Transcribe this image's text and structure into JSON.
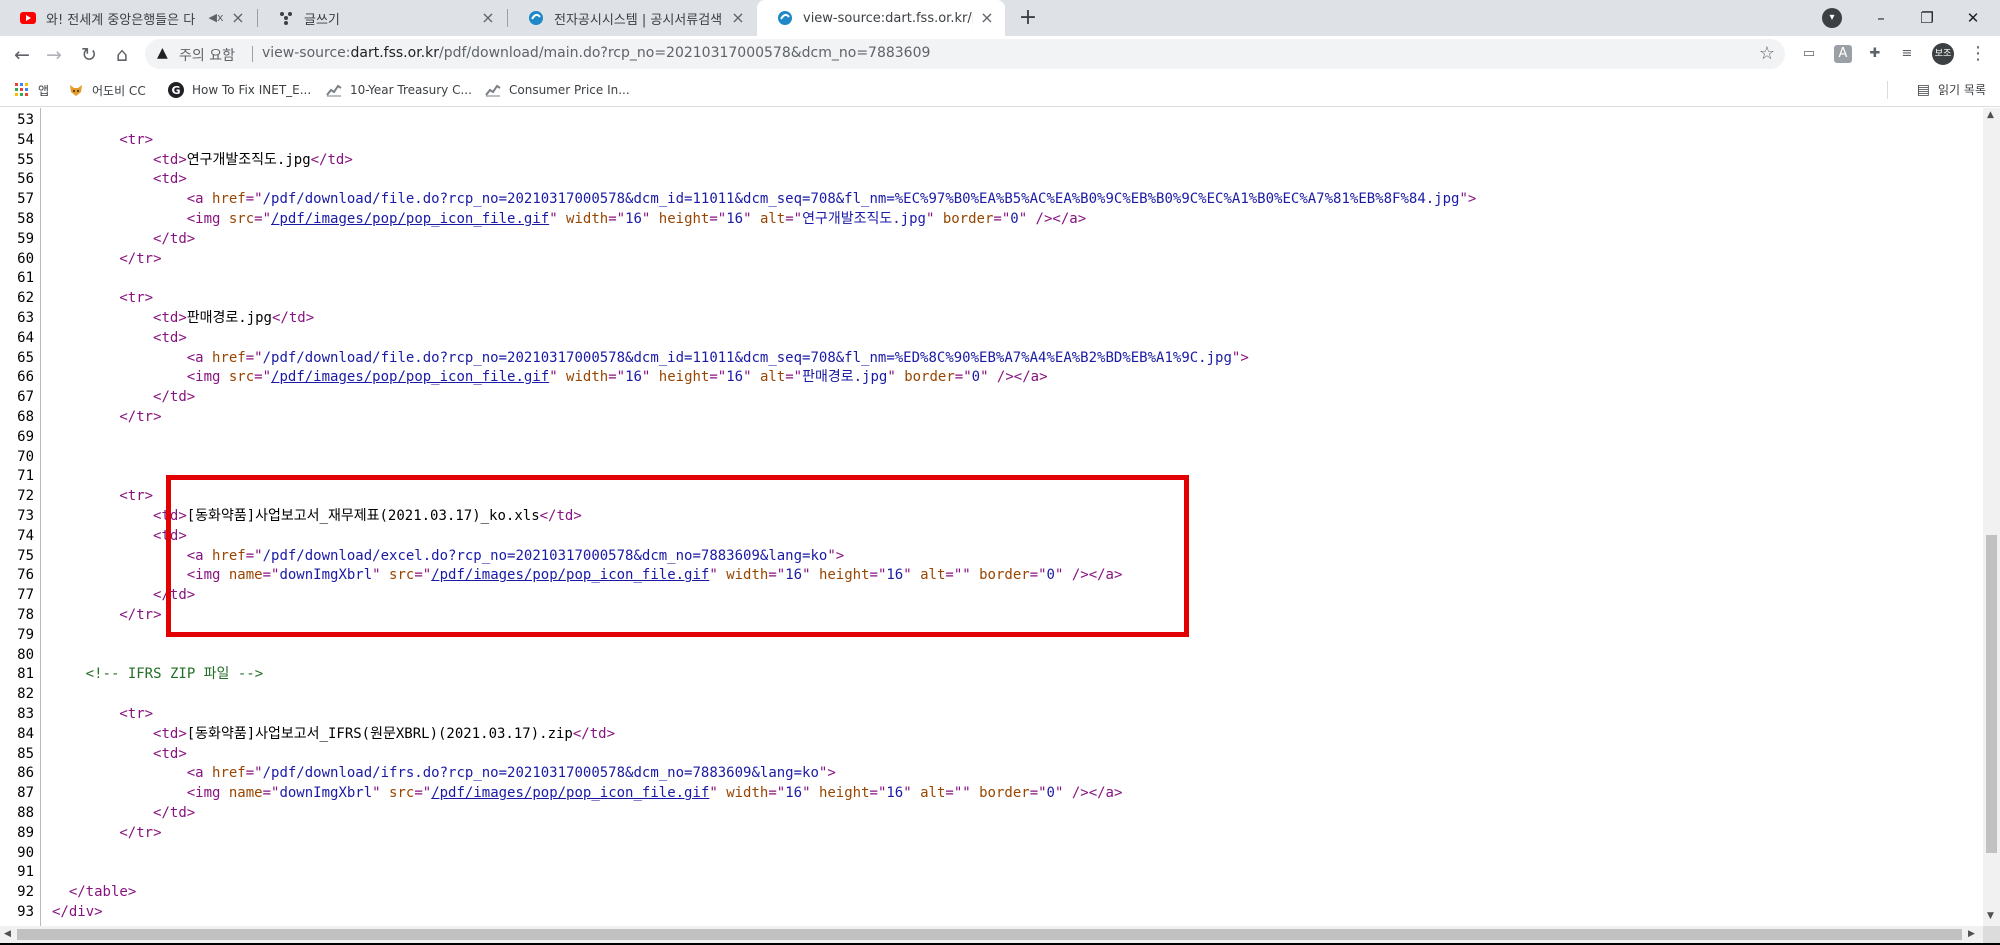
{
  "tabs": [
    {
      "title": "와! 전세계 중앙은행들은 다",
      "icon": "youtube-icon",
      "muted": true
    },
    {
      "title": "글쓰기",
      "icon": "blog-icon"
    },
    {
      "title": "전자공시시스템 | 공시서류검색 |",
      "icon": "dart-icon"
    },
    {
      "title": "view-source:dart.fss.or.kr/pdf/do",
      "icon": "dart-icon",
      "active": true
    }
  ],
  "toolbar": {
    "security_label": "주의 요함",
    "url_scheme": "view-source:",
    "url_host": "dart.fss.or.kr",
    "url_path": "/pdf/download/main.do?rcp_no=20210317000578&dcm_no=7883609",
    "profile_label": "보조"
  },
  "bookmarks": [
    {
      "label": "앱",
      "icon": "apps-grid-icon"
    },
    {
      "label": "어도비 CC",
      "icon": "fox-icon"
    },
    {
      "label": "How To Fix INET_E...",
      "icon": "g-logo-icon"
    },
    {
      "label": "10-Year Treasury C...",
      "icon": "chart-icon"
    },
    {
      "label": "Consumer Price In...",
      "icon": "chart-icon"
    }
  ],
  "reading_list": "읽기 목록",
  "source_lines": [
    {
      "n": 53,
      "indent": 0,
      "segs": []
    },
    {
      "n": 54,
      "indent": 4,
      "segs": [
        [
          "tag",
          "<tr>"
        ]
      ]
    },
    {
      "n": 55,
      "indent": 6,
      "segs": [
        [
          "tag",
          "<td>"
        ],
        [
          "txt",
          "연구개발조직도.jpg"
        ],
        [
          "tag",
          "</td>"
        ]
      ]
    },
    {
      "n": 56,
      "indent": 6,
      "segs": [
        [
          "tag",
          "<td>"
        ]
      ]
    },
    {
      "n": 57,
      "indent": 8,
      "segs": [
        [
          "tag",
          "<a "
        ],
        [
          "an",
          "href"
        ],
        [
          "tag",
          "=\""
        ],
        [
          "av",
          "/pdf/download/file.do?rcp_no=20210317000578&dcm_id=11011&dcm_seq=708&fl_nm=%EC%97%B0%EA%B5%AC%EA%B0%9C%EB%B0%9C%EC%A1%B0%EC%A7%81%EB%8F%84.jpg"
        ],
        [
          "tag",
          "\">"
        ]
      ]
    },
    {
      "n": 58,
      "indent": 8,
      "segs": [
        [
          "tag",
          "<img "
        ],
        [
          "an",
          "src"
        ],
        [
          "tag",
          "=\""
        ],
        [
          "lk",
          "/pdf/images/pop/pop_icon_file.gif"
        ],
        [
          "tag",
          "\" "
        ],
        [
          "an",
          "width"
        ],
        [
          "tag",
          "=\""
        ],
        [
          "av",
          "16"
        ],
        [
          "tag",
          "\" "
        ],
        [
          "an",
          "height"
        ],
        [
          "tag",
          "=\""
        ],
        [
          "av",
          "16"
        ],
        [
          "tag",
          "\" "
        ],
        [
          "an",
          "alt"
        ],
        [
          "tag",
          "=\""
        ],
        [
          "av",
          "연구개발조직도.jpg"
        ],
        [
          "tag",
          "\" "
        ],
        [
          "an",
          "border"
        ],
        [
          "tag",
          "=\""
        ],
        [
          "av",
          "0"
        ],
        [
          "tag",
          "\" /></a>"
        ]
      ]
    },
    {
      "n": 59,
      "indent": 6,
      "segs": [
        [
          "tag",
          "</td>"
        ]
      ]
    },
    {
      "n": 60,
      "indent": 4,
      "segs": [
        [
          "tag",
          "</tr>"
        ]
      ]
    },
    {
      "n": 61,
      "indent": 0,
      "segs": []
    },
    {
      "n": 62,
      "indent": 4,
      "segs": [
        [
          "tag",
          "<tr>"
        ]
      ]
    },
    {
      "n": 63,
      "indent": 6,
      "segs": [
        [
          "tag",
          "<td>"
        ],
        [
          "txt",
          "판매경로.jpg"
        ],
        [
          "tag",
          "</td>"
        ]
      ]
    },
    {
      "n": 64,
      "indent": 6,
      "segs": [
        [
          "tag",
          "<td>"
        ]
      ]
    },
    {
      "n": 65,
      "indent": 8,
      "segs": [
        [
          "tag",
          "<a "
        ],
        [
          "an",
          "href"
        ],
        [
          "tag",
          "=\""
        ],
        [
          "av",
          "/pdf/download/file.do?rcp_no=20210317000578&dcm_id=11011&dcm_seq=708&fl_nm=%ED%8C%90%EB%A7%A4%EA%B2%BD%EB%A1%9C.jpg"
        ],
        [
          "tag",
          "\">"
        ]
      ]
    },
    {
      "n": 66,
      "indent": 8,
      "segs": [
        [
          "tag",
          "<img "
        ],
        [
          "an",
          "src"
        ],
        [
          "tag",
          "=\""
        ],
        [
          "lk",
          "/pdf/images/pop/pop_icon_file.gif"
        ],
        [
          "tag",
          "\" "
        ],
        [
          "an",
          "width"
        ],
        [
          "tag",
          "=\""
        ],
        [
          "av",
          "16"
        ],
        [
          "tag",
          "\" "
        ],
        [
          "an",
          "height"
        ],
        [
          "tag",
          "=\""
        ],
        [
          "av",
          "16"
        ],
        [
          "tag",
          "\" "
        ],
        [
          "an",
          "alt"
        ],
        [
          "tag",
          "=\""
        ],
        [
          "av",
          "판매경로.jpg"
        ],
        [
          "tag",
          "\" "
        ],
        [
          "an",
          "border"
        ],
        [
          "tag",
          "=\""
        ],
        [
          "av",
          "0"
        ],
        [
          "tag",
          "\" /></a>"
        ]
      ]
    },
    {
      "n": 67,
      "indent": 6,
      "segs": [
        [
          "tag",
          "</td>"
        ]
      ]
    },
    {
      "n": 68,
      "indent": 4,
      "segs": [
        [
          "tag",
          "</tr>"
        ]
      ]
    },
    {
      "n": 69,
      "indent": 0,
      "segs": []
    },
    {
      "n": 70,
      "indent": 0,
      "segs": []
    },
    {
      "n": 71,
      "indent": 0,
      "segs": []
    },
    {
      "n": 72,
      "indent": 4,
      "segs": [
        [
          "tag",
          "<tr>"
        ]
      ]
    },
    {
      "n": 73,
      "indent": 6,
      "segs": [
        [
          "tag",
          "<td>"
        ],
        [
          "txt",
          "[동화약품]사업보고서_재무제표(2021.03.17)_ko.xls"
        ],
        [
          "tag",
          "</td>"
        ]
      ]
    },
    {
      "n": 74,
      "indent": 6,
      "segs": [
        [
          "tag",
          "<td>"
        ]
      ]
    },
    {
      "n": 75,
      "indent": 8,
      "segs": [
        [
          "tag",
          "<a "
        ],
        [
          "an",
          "href"
        ],
        [
          "tag",
          "=\""
        ],
        [
          "av",
          "/pdf/download/excel.do?rcp_no=20210317000578&dcm_no=7883609&lang=ko"
        ],
        [
          "tag",
          "\">"
        ]
      ]
    },
    {
      "n": 76,
      "indent": 8,
      "segs": [
        [
          "tag",
          "<img "
        ],
        [
          "an",
          "name"
        ],
        [
          "tag",
          "=\""
        ],
        [
          "av",
          "downImgXbrl"
        ],
        [
          "tag",
          "\" "
        ],
        [
          "an",
          "src"
        ],
        [
          "tag",
          "=\""
        ],
        [
          "lk",
          "/pdf/images/pop/pop_icon_file.gif"
        ],
        [
          "tag",
          "\" "
        ],
        [
          "an",
          "width"
        ],
        [
          "tag",
          "=\""
        ],
        [
          "av",
          "16"
        ],
        [
          "tag",
          "\" "
        ],
        [
          "an",
          "height"
        ],
        [
          "tag",
          "=\""
        ],
        [
          "av",
          "16"
        ],
        [
          "tag",
          "\" "
        ],
        [
          "an",
          "alt"
        ],
        [
          "tag",
          "=\"\" "
        ],
        [
          "an",
          "border"
        ],
        [
          "tag",
          "=\""
        ],
        [
          "av",
          "0"
        ],
        [
          "tag",
          "\" /></a>"
        ]
      ]
    },
    {
      "n": 77,
      "indent": 6,
      "segs": [
        [
          "tag",
          "</td>"
        ]
      ]
    },
    {
      "n": 78,
      "indent": 4,
      "segs": [
        [
          "tag",
          "</tr>"
        ]
      ]
    },
    {
      "n": 79,
      "indent": 0,
      "segs": []
    },
    {
      "n": 80,
      "indent": 0,
      "segs": []
    },
    {
      "n": 81,
      "indent": 2,
      "segs": [
        [
          "cm",
          "<!-- IFRS ZIP 파일 -->"
        ]
      ]
    },
    {
      "n": 82,
      "indent": 0,
      "segs": []
    },
    {
      "n": 83,
      "indent": 4,
      "segs": [
        [
          "tag",
          "<tr>"
        ]
      ]
    },
    {
      "n": 84,
      "indent": 6,
      "segs": [
        [
          "tag",
          "<td>"
        ],
        [
          "txt",
          "[동화약품]사업보고서_IFRS(원문XBRL)(2021.03.17).zip"
        ],
        [
          "tag",
          "</td>"
        ]
      ]
    },
    {
      "n": 85,
      "indent": 6,
      "segs": [
        [
          "tag",
          "<td>"
        ]
      ]
    },
    {
      "n": 86,
      "indent": 8,
      "segs": [
        [
          "tag",
          "<a "
        ],
        [
          "an",
          "href"
        ],
        [
          "tag",
          "=\""
        ],
        [
          "av",
          "/pdf/download/ifrs.do?rcp_no=20210317000578&dcm_no=7883609&lang=ko"
        ],
        [
          "tag",
          "\">"
        ]
      ]
    },
    {
      "n": 87,
      "indent": 8,
      "segs": [
        [
          "tag",
          "<img "
        ],
        [
          "an",
          "name"
        ],
        [
          "tag",
          "=\""
        ],
        [
          "av",
          "downImgXbrl"
        ],
        [
          "tag",
          "\" "
        ],
        [
          "an",
          "src"
        ],
        [
          "tag",
          "=\""
        ],
        [
          "lk",
          "/pdf/images/pop/pop_icon_file.gif"
        ],
        [
          "tag",
          "\" "
        ],
        [
          "an",
          "width"
        ],
        [
          "tag",
          "=\""
        ],
        [
          "av",
          "16"
        ],
        [
          "tag",
          "\" "
        ],
        [
          "an",
          "height"
        ],
        [
          "tag",
          "=\""
        ],
        [
          "av",
          "16"
        ],
        [
          "tag",
          "\" "
        ],
        [
          "an",
          "alt"
        ],
        [
          "tag",
          "=\"\" "
        ],
        [
          "an",
          "border"
        ],
        [
          "tag",
          "=\""
        ],
        [
          "av",
          "0"
        ],
        [
          "tag",
          "\" /></a>"
        ]
      ]
    },
    {
      "n": 88,
      "indent": 6,
      "segs": [
        [
          "tag",
          "</td>"
        ]
      ]
    },
    {
      "n": 89,
      "indent": 4,
      "segs": [
        [
          "tag",
          "</tr>"
        ]
      ]
    },
    {
      "n": 90,
      "indent": 0,
      "segs": []
    },
    {
      "n": 91,
      "indent": 0,
      "segs": []
    },
    {
      "n": 92,
      "indent": 1,
      "segs": [
        [
          "tag",
          "</table>"
        ]
      ]
    },
    {
      "n": 93,
      "indent": 0,
      "segs": [
        [
          "tag",
          "</div>"
        ]
      ]
    }
  ],
  "colors": {
    "tag": "#881280",
    "attr_name": "#994500",
    "attr_value": "#1a1aa6",
    "comment": "#236e25",
    "highlight_box": "#e20000"
  }
}
